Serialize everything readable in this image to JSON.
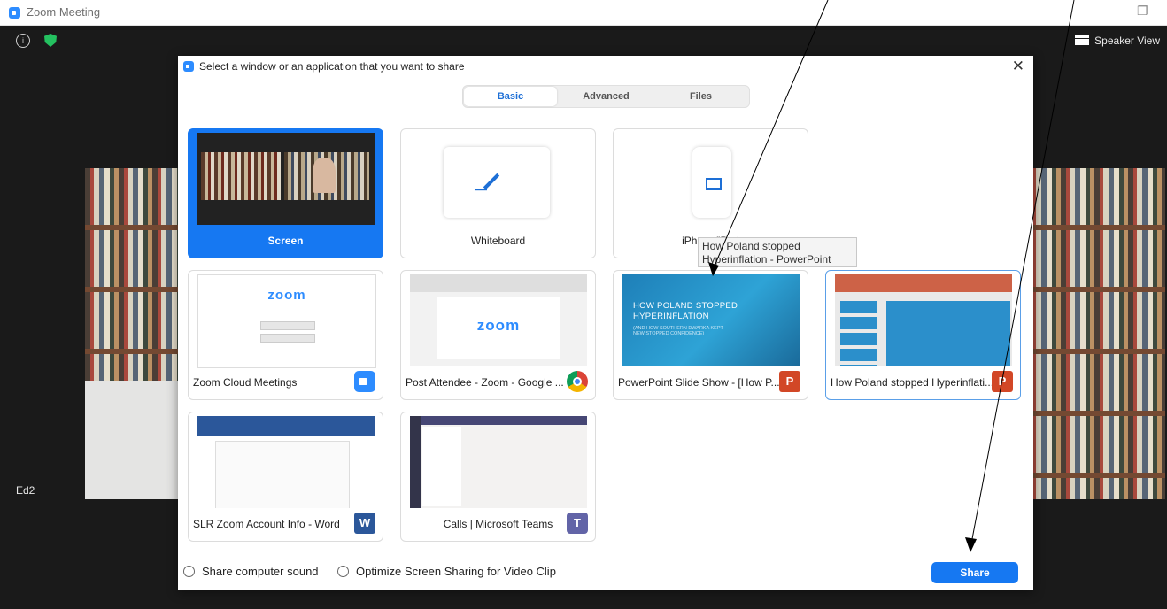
{
  "window": {
    "title": "Zoom Meeting"
  },
  "meeting": {
    "speaker_view_label": "Speaker View",
    "participant_name": "Ed2"
  },
  "dialog": {
    "title": "Select a window or an application that you want to share",
    "tabs": [
      "Basic",
      "Advanced",
      "Files"
    ],
    "active_tab": "Basic",
    "items": [
      {
        "label": "Screen",
        "selected": true
      },
      {
        "label": "Whiteboard"
      },
      {
        "label": "iPhone/iPad"
      },
      {
        "label": "Zoom Cloud Meetings",
        "app_icon": "zoom-icon"
      },
      {
        "label": "Post Attendee - Zoom - Google ...",
        "app_icon": "chrome-icon"
      },
      {
        "label": "PowerPoint Slide Show - [How P...",
        "app_icon": "powerpoint-icon"
      },
      {
        "label": "How Poland stopped Hyperinflati...",
        "app_icon": "powerpoint-icon",
        "highlighted": true
      },
      {
        "label": "SLR Zoom Account Info - Word",
        "app_icon": "word-icon"
      },
      {
        "label": "Calls | Microsoft Teams",
        "app_icon": "teams-icon"
      }
    ],
    "thumbnail_texts": {
      "zoom_word": "zoom",
      "slide_title": "HOW POLAND STOPPED HYPERINFLATION",
      "slide_subtitle": "(AND HOW SOUTHERN DWARKA KEPT NEW STOPPED CONFIDENCE)"
    },
    "tooltip": "How Poland stopped Hyperinflation - PowerPoint",
    "footer": {
      "share_sound_label": "Share computer sound",
      "optimize_label": "Optimize Screen Sharing for Video Clip",
      "share_button": "Share"
    }
  },
  "colors": {
    "accent": "#1678f2",
    "zoom_blue": "#2d8cff"
  }
}
